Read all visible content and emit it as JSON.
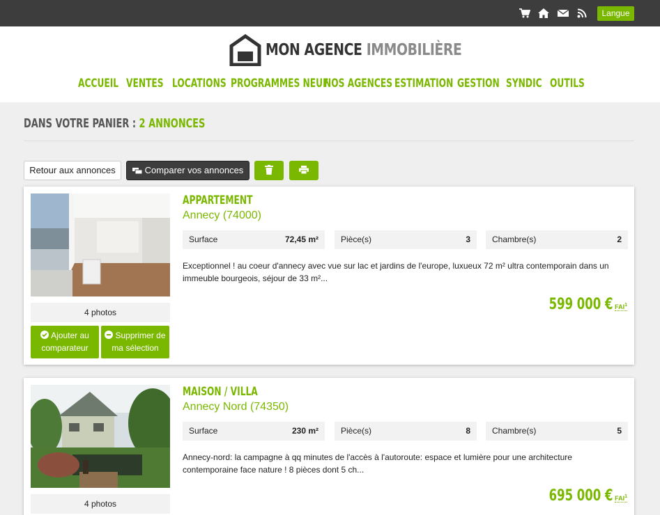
{
  "topbar": {
    "icons": [
      "cart-icon",
      "home-icon",
      "mail-icon",
      "rss-icon"
    ],
    "language_label": "Langue"
  },
  "logo": {
    "text_dark": "MON AGENCE",
    "text_light": "IMMOBILIÈRE"
  },
  "nav": [
    "ACCUEIL",
    "VENTES",
    "LOCATIONS",
    "PROGRAMMES NEUF",
    "NOS AGENCES",
    "ESTIMATION",
    "GESTION",
    "SYNDIC",
    "OUTILS"
  ],
  "cart": {
    "title_prefix": "DANS VOTRE PANIER :",
    "title_count": "2 ANNONCES"
  },
  "toolbar": {
    "back_label": "Retour aux annonces",
    "compare_label": "Comparer vos annonces",
    "trash_icon": "trash-icon",
    "print_icon": "print-icon"
  },
  "listings": [
    {
      "type": "APPARTEMENT",
      "city": "Annecy (74000)",
      "photos": "4 photos",
      "add_label": "Ajouter au comparateur",
      "remove_label": "Supprimer de ma sélection",
      "specs": [
        {
          "label": "Surface",
          "value": "72,45 m²"
        },
        {
          "label": "Pièce(s)",
          "value": "3"
        },
        {
          "label": "Chambre(s)",
          "value": "2"
        }
      ],
      "description": "Exceptionnel ! au coeur d'annecy avec vue sur lac et jardins de l'europe, luxueux 72 m² ultra contemporain dans un immeuble bourgeois, séjour de 33 m²...",
      "price": "599 000 €",
      "price_suffix": "FAI",
      "price_note": "1"
    },
    {
      "type": "MAISON / VILLA",
      "city": "Annecy Nord (74350)",
      "photos": "4 photos",
      "specs": [
        {
          "label": "Surface",
          "value": "230 m²"
        },
        {
          "label": "Pièce(s)",
          "value": "8"
        },
        {
          "label": "Chambre(s)",
          "value": "5"
        }
      ],
      "description": "Annecy-nord: la campagne à qq minutes de l'accès à l'autoroute: espace et lumière pour une architecture contemporaine face nature ! 8 pièces dont 5 ch...",
      "price": "695 000 €",
      "price_suffix": "FAI",
      "price_note": "1"
    }
  ],
  "colors": {
    "accent": "#7ab800",
    "topbar": "#3d3d3d",
    "background": "#efefef"
  }
}
